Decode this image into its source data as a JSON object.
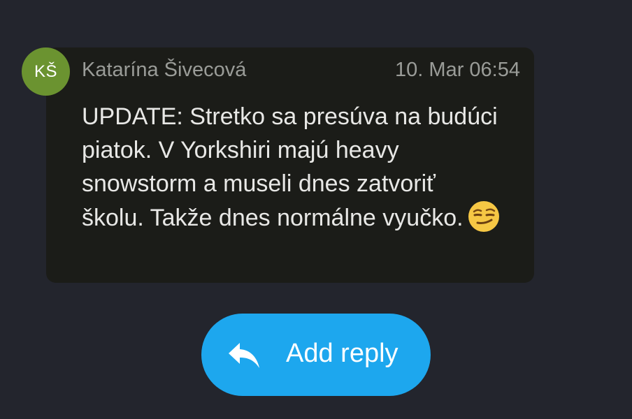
{
  "message": {
    "avatar_initials": "KŠ",
    "avatar_color": "#6b9330",
    "sender": "Katarína Šivecová",
    "timestamp": "10. Mar 06:54",
    "body": "UPDATE: Stretko sa presúva na budúci piatok. V Yorkshiri majú heavy snowstorm a museli dnes zatvoriť školu. Takže dnes normálne vyučko.",
    "emoji": "smirking-face-icon"
  },
  "actions": {
    "reply_label": "Add reply",
    "reply_icon": "reply-arrow-icon",
    "reply_color": "#1da7ee"
  }
}
